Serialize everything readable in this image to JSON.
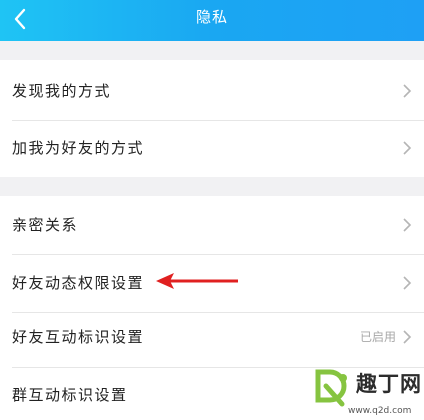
{
  "header": {
    "title": "隐私"
  },
  "groups": [
    {
      "items": [
        {
          "label": "发现我的方式"
        },
        {
          "label": "加我为好友的方式"
        }
      ]
    },
    {
      "items": [
        {
          "label": "亲密关系"
        },
        {
          "label": "好友动态权限设置"
        },
        {
          "label": "好友互动标识设置",
          "value": "已启用"
        },
        {
          "label": "群互动标识设置"
        }
      ]
    }
  ],
  "watermark": {
    "name": "趣丁网",
    "url": "www.q2d.com"
  },
  "colors": {
    "header": "#1aa7f2",
    "arrow": "#e02020"
  }
}
